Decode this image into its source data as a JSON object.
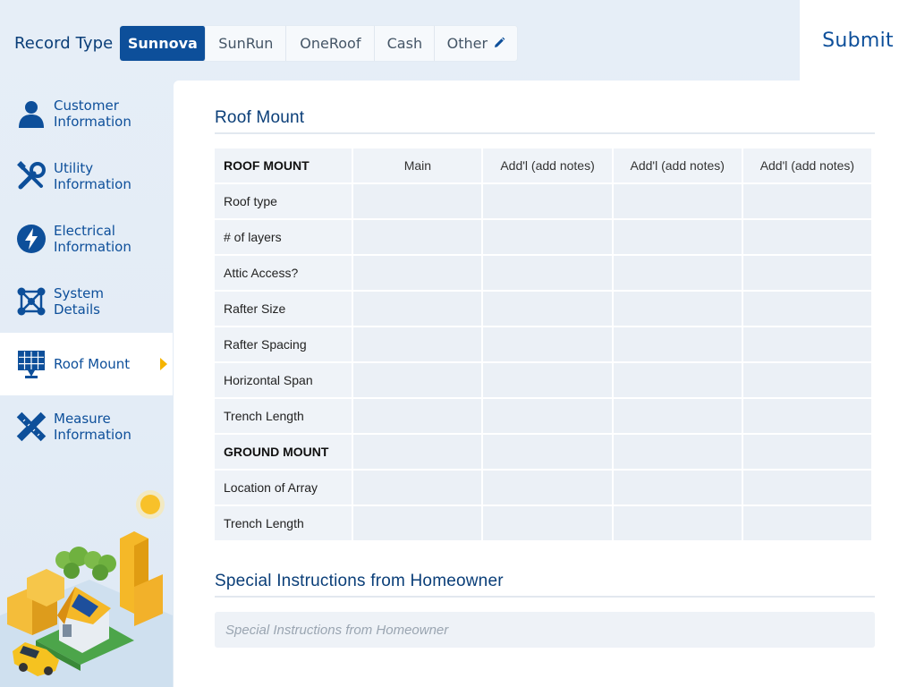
{
  "header": {
    "record_type_label": "Record Type",
    "options": [
      {
        "label": "Sunnova",
        "active": true
      },
      {
        "label": "SunRun",
        "active": false
      },
      {
        "label": "OneRoof",
        "active": false
      },
      {
        "label": "Cash",
        "active": false
      },
      {
        "label": "Other",
        "active": false,
        "icon": "pencil-icon"
      }
    ],
    "submit_label": "Submit"
  },
  "sidebar": {
    "items": [
      {
        "label": "Customer Information",
        "icon": "person-icon",
        "active": false
      },
      {
        "label": "Utility Information",
        "icon": "tools-icon",
        "active": false
      },
      {
        "label": "Electrical Information",
        "icon": "lightning-icon",
        "active": false
      },
      {
        "label": "System Details",
        "icon": "network-icon",
        "active": false
      },
      {
        "label": "Roof Mount",
        "icon": "solar-panel-icon",
        "active": true
      },
      {
        "label": "Measure Information",
        "icon": "ruler-pencil-icon",
        "active": false
      }
    ]
  },
  "main": {
    "section_title": "Roof Mount",
    "table": {
      "header": [
        "ROOF MOUNT",
        "Main",
        "Add'l (add notes)",
        "Add'l (add notes)",
        "Add'l (add notes)"
      ],
      "rows": [
        {
          "label": "Roof type",
          "bold": false
        },
        {
          "label": "# of layers",
          "bold": false
        },
        {
          "label": "Attic Access?",
          "bold": false
        },
        {
          "label": "Rafter Size",
          "bold": false
        },
        {
          "label": "Rafter Spacing",
          "bold": false
        },
        {
          "label": "Horizontal Span",
          "bold": false
        },
        {
          "label": "Trench Length",
          "bold": false
        },
        {
          "label": "GROUND MOUNT",
          "bold": true
        },
        {
          "label": "Location of Array",
          "bold": false
        },
        {
          "label": "Trench Length",
          "bold": false
        }
      ]
    },
    "instructions_title": "Special Instructions from Homeowner",
    "instructions_placeholder": "Special Instructions from Homeowner"
  },
  "colors": {
    "primary": "#0d4f9a",
    "accent": "#f5b400",
    "background": "#e2ebf5"
  }
}
